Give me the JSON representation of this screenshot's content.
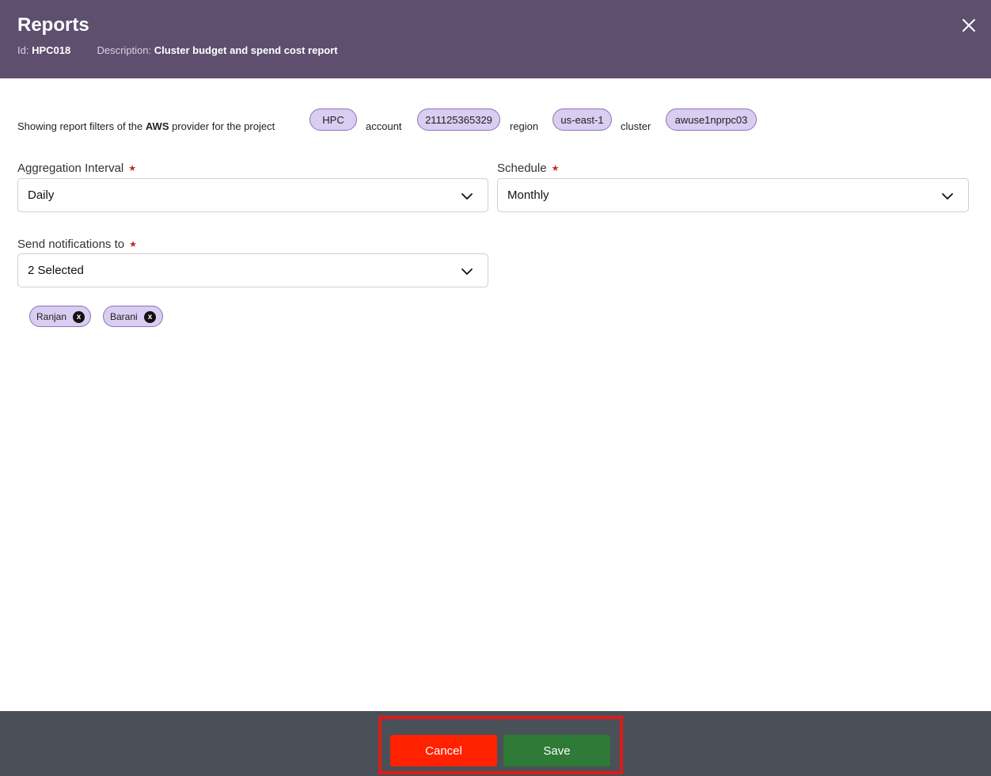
{
  "header": {
    "title": "Reports",
    "id_label": "Id:",
    "id_value": "HPC018",
    "description_label": "Description:",
    "description_value": "Cluster budget and spend cost report",
    "close_icon": "close-icon"
  },
  "filters": {
    "prefix_text": "Showing report filters of the",
    "provider": "AWS",
    "suffix_text": "provider for the project",
    "project": "HPC",
    "account_label": "account",
    "account": "211125365329",
    "region_label": "region",
    "region": "us-east-1",
    "cluster_label": "cluster",
    "cluster": "awuse1nprpc03"
  },
  "form": {
    "aggregation": {
      "label": "Aggregation Interval",
      "value": "Daily"
    },
    "schedule": {
      "label": "Schedule",
      "value": "Monthly"
    },
    "notifications": {
      "label": "Send notifications to",
      "value": "2 Selected",
      "selected": [
        "Ranjan",
        "Barani"
      ],
      "remove_glyph": "x"
    },
    "required_marker": "★"
  },
  "footer": {
    "cancel_label": "Cancel",
    "save_label": "Save"
  },
  "colors": {
    "header_bg": "#5e4f6f",
    "pill_bg": "#d9cdf1",
    "pill_border": "#8a74b8",
    "cancel_bg": "#ff2100",
    "save_bg": "#2e7a36",
    "footer_bg": "#4a5058",
    "highlight_border": "#e01919"
  }
}
